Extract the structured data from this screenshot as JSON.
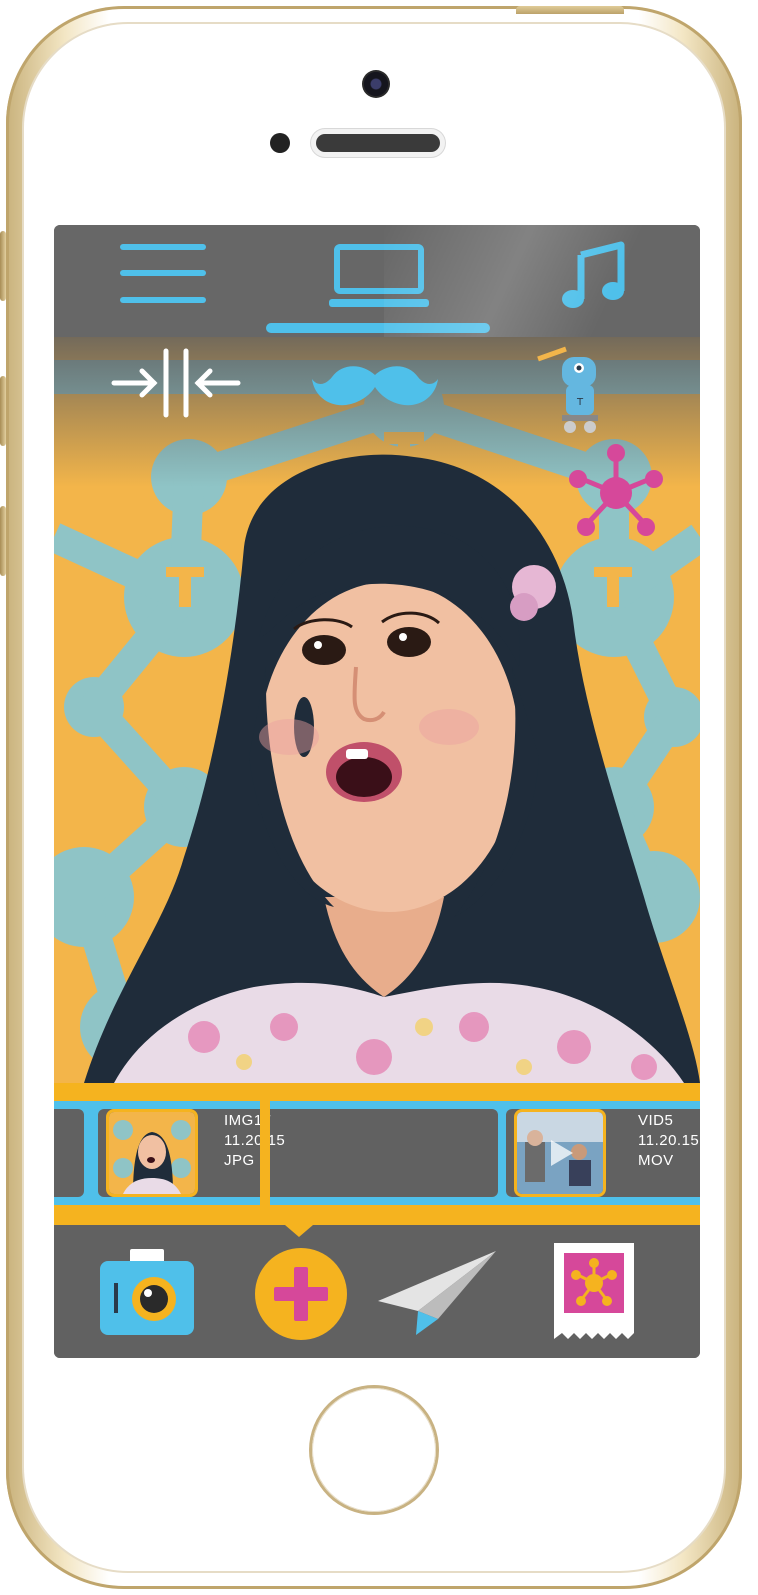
{
  "top_nav": {
    "items": [
      {
        "name": "menu",
        "icon": "hamburger-menu-icon"
      },
      {
        "name": "screen",
        "icon": "laptop-icon",
        "active": true
      },
      {
        "name": "music",
        "icon": "music-note-icon"
      }
    ]
  },
  "photo_tools": {
    "left_tool": "compress-arrows-icon",
    "center_tool": "mustache-icon",
    "right_tool": "robot-mascot-icon",
    "sticker": "molecule-sticker-icon"
  },
  "media_strip": {
    "items": [
      {
        "name": "IMG17",
        "date": "11.20.15",
        "type": "JPG"
      },
      {
        "name": "VID5",
        "date": "11.20.15",
        "type": "MOV"
      }
    ]
  },
  "bottom_actions": [
    {
      "name": "camera",
      "icon": "camera-icon"
    },
    {
      "name": "add",
      "icon": "plus-icon"
    },
    {
      "name": "send",
      "icon": "paper-plane-icon"
    },
    {
      "name": "stamp",
      "icon": "stamp-icon"
    }
  ],
  "colors": {
    "accent_blue": "#4fc0ea",
    "accent_yellow": "#f5b31f",
    "accent_pink": "#d6489a",
    "bar_gray": "#616161"
  }
}
